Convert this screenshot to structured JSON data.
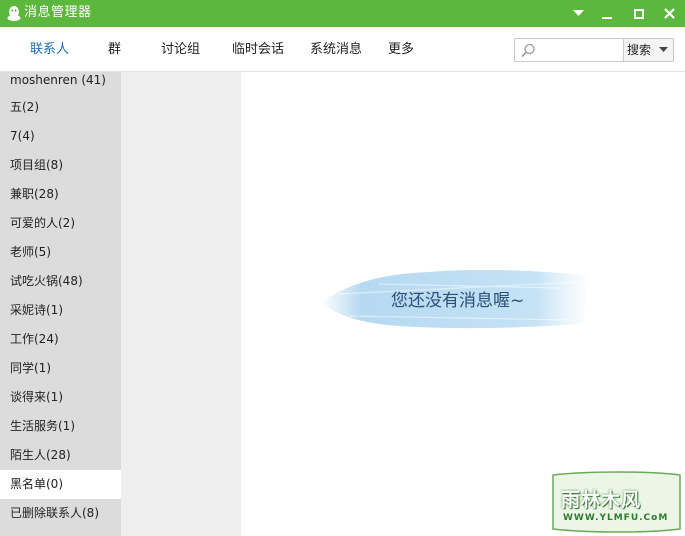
{
  "window": {
    "title": "消息管理器",
    "accent": "#5cb83c",
    "controls": [
      "dropdown-icon",
      "minimize-icon",
      "maximize-icon",
      "close-icon"
    ]
  },
  "tabs": [
    {
      "label": "联系人",
      "active": true
    },
    {
      "label": "群",
      "active": false
    },
    {
      "label": "讨论组",
      "active": false
    },
    {
      "label": "临时会话",
      "active": false
    },
    {
      "label": "系统消息",
      "active": false
    },
    {
      "label": "更多",
      "active": false
    }
  ],
  "search": {
    "value": "",
    "placeholder": "",
    "button_label": "搜索"
  },
  "sidebar": {
    "items": [
      {
        "label": "moshenren (41)"
      },
      {
        "label": "五(2)"
      },
      {
        "label": "7(4)"
      },
      {
        "label": "项目组(8)"
      },
      {
        "label": "兼职(28)"
      },
      {
        "label": "可爱的人(2)"
      },
      {
        "label": "老师(5)"
      },
      {
        "label": "试吃火锅(48)"
      },
      {
        "label": "采妮诗(1)"
      },
      {
        "label": "工作(24)"
      },
      {
        "label": "同学(1)"
      },
      {
        "label": "谈得来(1)"
      },
      {
        "label": "生活服务(1)"
      },
      {
        "label": "陌生人(28)"
      },
      {
        "label": "黑名单(0)",
        "selected": true
      },
      {
        "label": "已删除联系人(8)"
      }
    ]
  },
  "content": {
    "empty_message": "您还没有消息喔~"
  },
  "watermark": {
    "main": "雨林木风",
    "sub": "WWW.YLMFU.CoM"
  }
}
